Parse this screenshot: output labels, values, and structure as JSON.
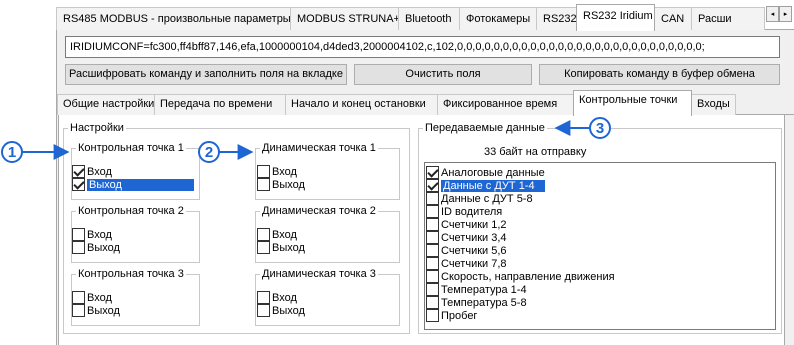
{
  "top_tabs": [
    {
      "label": "RS485 MODBUS - произвольные параметры"
    },
    {
      "label": "MODBUS STRUNA+"
    },
    {
      "label": "Bluetooth"
    },
    {
      "label": "Фотокамеры"
    },
    {
      "label": "RS232"
    },
    {
      "label": "RS232 Iridium",
      "active": true
    },
    {
      "label": "CAN"
    },
    {
      "label": "Расши"
    }
  ],
  "tab_scroll": {
    "left": "◂",
    "right": "▸"
  },
  "command": {
    "value": "IRIDIUMCONF=fc300,ff4bff87,146,efa,1000000104,d4ded3,2000004102,c,102,0,0,0,0,0,0,0,0,0,0,0,0,0,0,0,0,0,0,0,0,0,0,0,0,0,0,0;"
  },
  "buttons": {
    "decode": "Расшифровать команду и заполнить поля на вкладке",
    "clear": "Очистить поля",
    "copy": "Копировать команду в буфер обмена"
  },
  "inner_tabs": [
    {
      "label": "Общие настройки"
    },
    {
      "label": "Передача по времени"
    },
    {
      "label": "Начало и конец остановки"
    },
    {
      "label": "Фиксированное время"
    },
    {
      "label": "Контрольные точки",
      "active": true
    },
    {
      "label": "Входы"
    }
  ],
  "settings": {
    "title": "Настройки",
    "checkpoints": [
      {
        "title": "Контрольная точка 1",
        "entry": {
          "label": "Вход",
          "checked": true
        },
        "exit": {
          "label": "Выход",
          "checked": true,
          "selected": true
        }
      },
      {
        "title": "Контрольная точка 2",
        "entry": {
          "label": "Вход",
          "checked": false
        },
        "exit": {
          "label": "Выход",
          "checked": false
        }
      },
      {
        "title": "Контрольная точка 3",
        "entry": {
          "label": "Вход",
          "checked": false
        },
        "exit": {
          "label": "Выход",
          "checked": false
        }
      }
    ],
    "dynamic_points": [
      {
        "title": "Динамическая точка 1",
        "entry": {
          "label": "Вход",
          "checked": false
        },
        "exit": {
          "label": "Выход",
          "checked": false
        }
      },
      {
        "title": "Динамическая точка 2",
        "entry": {
          "label": "Вход",
          "checked": false
        },
        "exit": {
          "label": "Выход",
          "checked": false
        }
      },
      {
        "title": "Динамическая точка 3",
        "entry": {
          "label": "Вход",
          "checked": false
        },
        "exit": {
          "label": "Выход",
          "checked": false
        }
      }
    ]
  },
  "transmitted": {
    "title": "Передаваемые данные",
    "byte_count": "33 байт на отправку",
    "items": [
      {
        "label": "Аналоговые данные",
        "checked": true
      },
      {
        "label": "Данные с ДУТ 1-4",
        "checked": true,
        "selected": true
      },
      {
        "label": "Данные с ДУТ 5-8",
        "checked": false
      },
      {
        "label": "ID водителя",
        "checked": false
      },
      {
        "label": "Счетчики 1,2",
        "checked": false
      },
      {
        "label": "Счетчики 3,4",
        "checked": false
      },
      {
        "label": "Счетчики 5,6",
        "checked": false
      },
      {
        "label": "Счетчики 7,8",
        "checked": false
      },
      {
        "label": "Скорость, направление движения",
        "checked": false
      },
      {
        "label": "Температура 1-4",
        "checked": false
      },
      {
        "label": "Температура 5-8",
        "checked": false
      },
      {
        "label": "Пробег",
        "checked": false
      }
    ]
  },
  "callouts": [
    "1",
    "2",
    "3"
  ],
  "colors": {
    "callout": "#1e66d3",
    "selection": "#1e66d3"
  }
}
